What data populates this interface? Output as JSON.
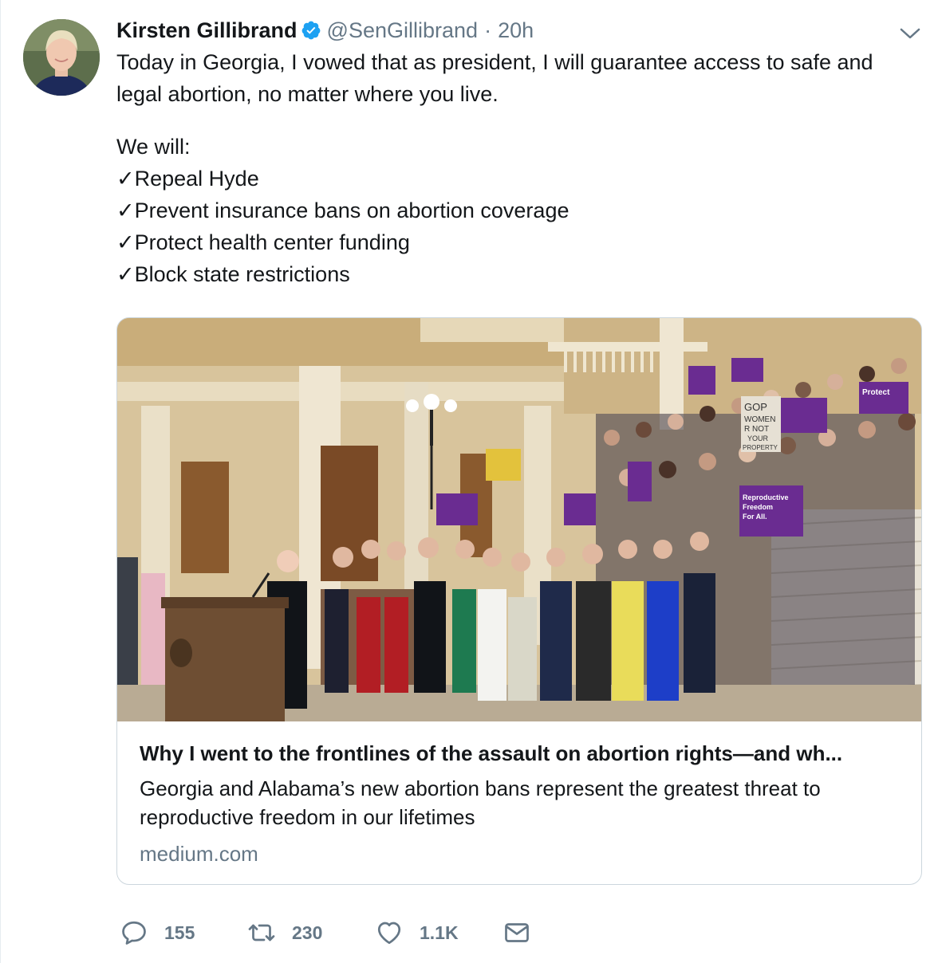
{
  "tweet": {
    "author_name": "Kirsten Gillibrand",
    "handle": "@SenGillibrand",
    "separator": "·",
    "time": "20h",
    "text_intro": "Today in Georgia, I vowed that as president, I will guarantee access to safe and legal abortion, no matter where you live.",
    "text_we_will": "We will:",
    "checklist": [
      "✓Repeal Hyde",
      "✓Prevent insurance bans on abortion coverage",
      "✓Protect health center funding",
      "✓Block state restrictions"
    ]
  },
  "card": {
    "title": "Why I went to the frontlines of the assault on abortion rights—and wh...",
    "description": "Georgia and Alabama’s new abortion bans represent the greatest threat to reproductive freedom in our lifetimes",
    "domain": "medium.com",
    "photo_signs": [
      "GOP",
      "WOMEN",
      "R NOT",
      "YOUR",
      "PROPERTY",
      "Reproductive",
      "Freedom",
      "For All.",
      "Protect"
    ]
  },
  "actions": {
    "replies": "155",
    "retweets": "230",
    "likes": "1.1K"
  },
  "colors": {
    "verified": "#1da1f2",
    "muted": "#657786",
    "sign_purple": "#6a2c91"
  }
}
